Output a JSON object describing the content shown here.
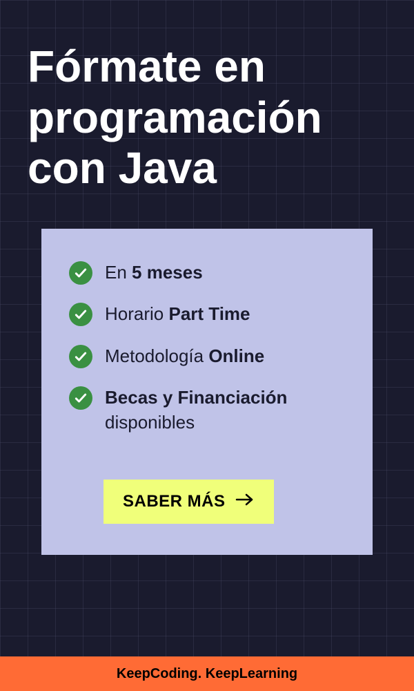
{
  "heading": "Fórmate en programación con Java",
  "features": [
    {
      "prefix": "En ",
      "bold": "5 meses",
      "suffix": ""
    },
    {
      "prefix": "Horario ",
      "bold": "Part Time",
      "suffix": ""
    },
    {
      "prefix": "Metodología ",
      "bold": "Online",
      "suffix": ""
    },
    {
      "prefix": "",
      "bold": "Becas y Financiación",
      "suffix": " disponibles"
    }
  ],
  "cta": {
    "label": "SABER MÁS"
  },
  "footer": {
    "text": "KeepCoding. KeepLearning"
  }
}
